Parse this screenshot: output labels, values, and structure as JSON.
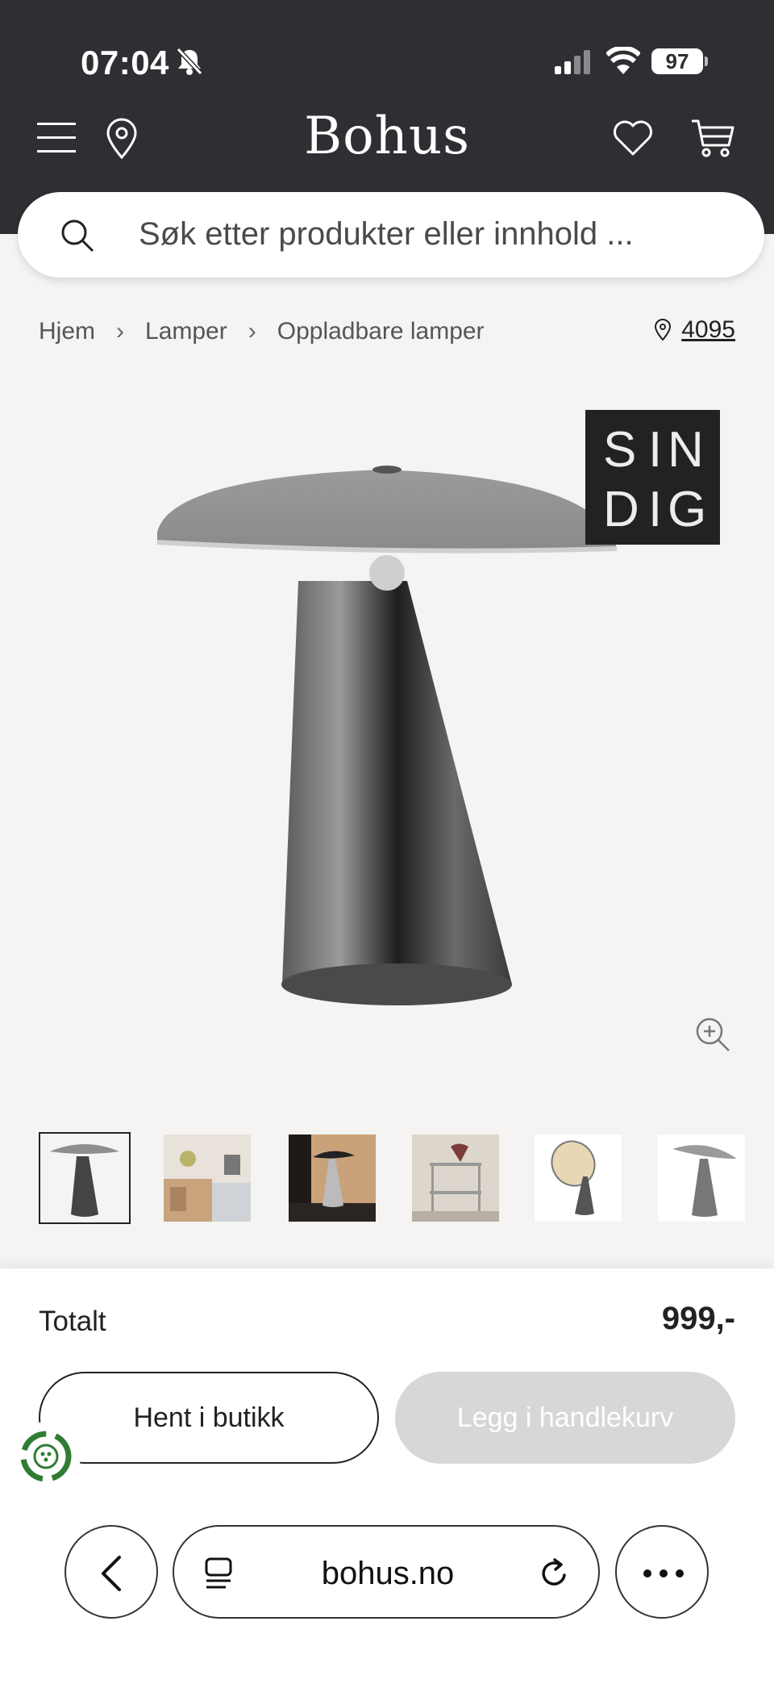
{
  "status_bar": {
    "time": "07:04",
    "battery": "97"
  },
  "header": {
    "logo": "Bohus"
  },
  "search": {
    "placeholder": "Søk etter produkter eller innhold ..."
  },
  "breadcrumb": {
    "items": [
      "Hjem",
      "Lamper",
      "Oppladbare lamper"
    ]
  },
  "store": {
    "id": "4095"
  },
  "brand_badge": {
    "letters": [
      "S",
      "I",
      "N",
      "D",
      "I",
      "G"
    ]
  },
  "thumbnails": {
    "count": 6,
    "active_index": 0
  },
  "summary": {
    "total_label": "Totalt",
    "total_value": "999,-"
  },
  "actions": {
    "pickup_label": "Hent i butikk",
    "add_to_cart_label": "Legg i handlekurv"
  },
  "browser": {
    "url": "bohus.no"
  },
  "colors": {
    "header_bg": "#2f2f33",
    "page_bg": "#f5f4f2",
    "disabled_btn": "#d7d7d7",
    "eco_green": "#2e7d32"
  }
}
